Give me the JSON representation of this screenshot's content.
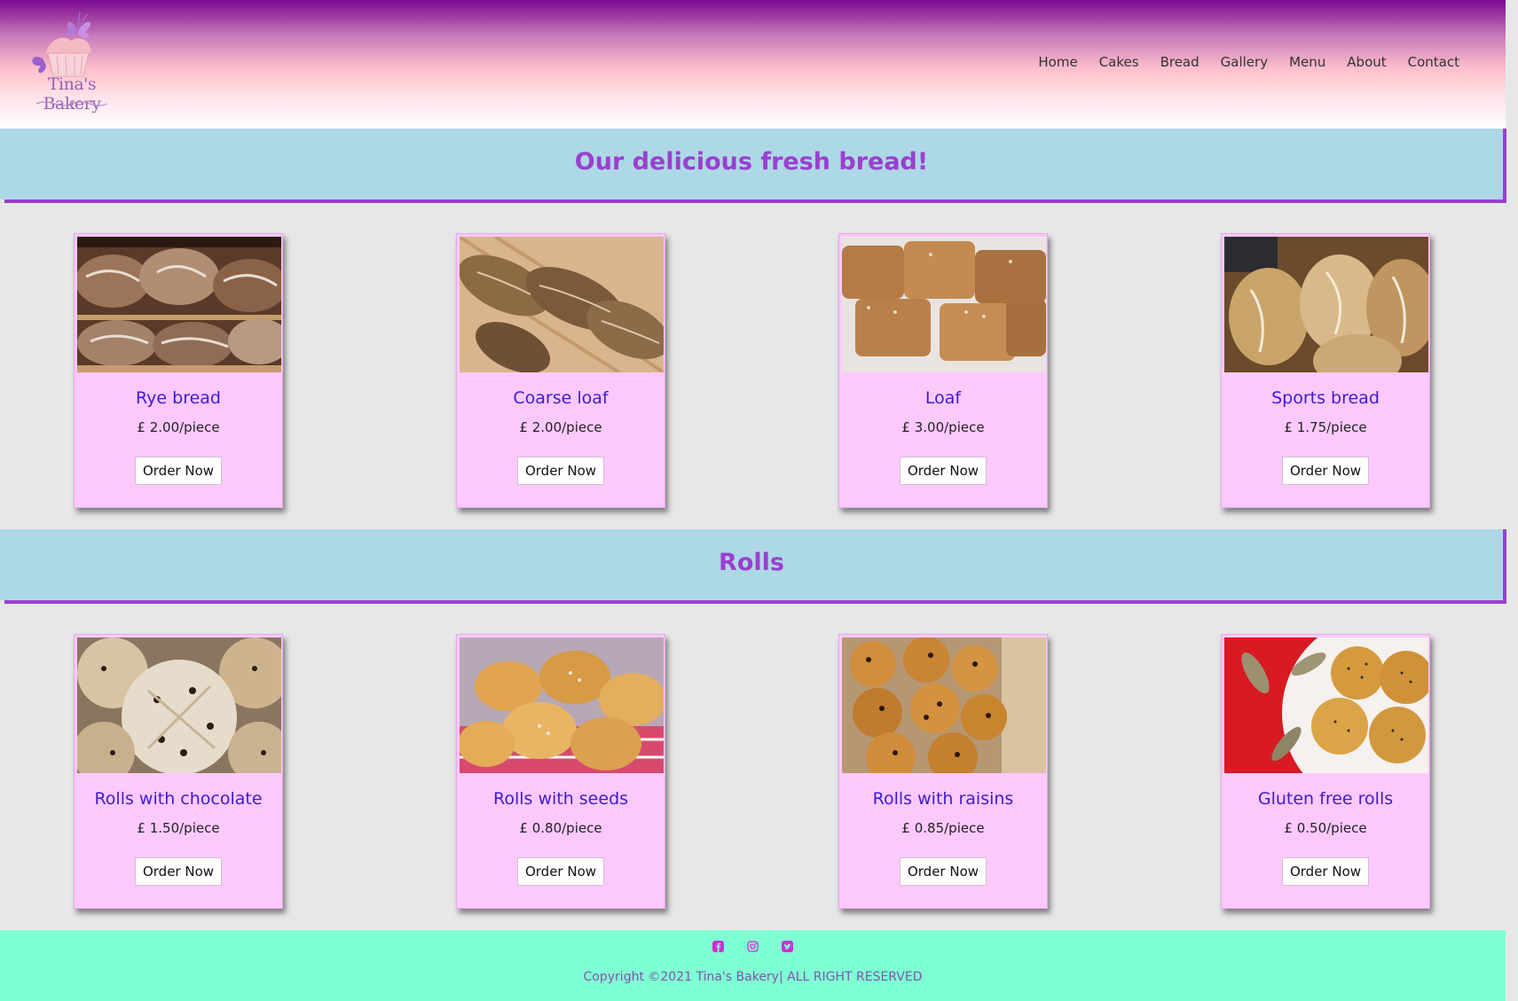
{
  "header": {
    "logo_text": "Tina's Bakery",
    "nav": [
      "Home",
      "Cakes",
      "Bread",
      "Gallery",
      "Menu",
      "About",
      "Contact"
    ]
  },
  "bread_section": {
    "title": "Our delicious fresh bread!",
    "items": [
      {
        "name": "Rye bread",
        "price": "£ 2.00/piece",
        "button": "Order Now"
      },
      {
        "name": "Coarse loaf",
        "price": "£ 2.00/piece",
        "button": "Order Now"
      },
      {
        "name": "Loaf",
        "price": "£ 3.00/piece",
        "button": "Order Now"
      },
      {
        "name": "Sports bread",
        "price": "£ 1.75/piece",
        "button": "Order Now"
      }
    ]
  },
  "rolls_section": {
    "title": "Rolls",
    "items": [
      {
        "name": "Rolls with chocolate",
        "price": "£ 1.50/piece",
        "button": "Order Now"
      },
      {
        "name": "Rolls with seeds",
        "price": "£ 0.80/piece",
        "button": "Order Now"
      },
      {
        "name": "Rolls with raisins",
        "price": "£ 0.85/piece",
        "button": "Order Now"
      },
      {
        "name": "Gluten free rolls",
        "price": "£ 0.50/piece",
        "button": "Order Now"
      }
    ]
  },
  "footer": {
    "social_icons": [
      "facebook-icon",
      "instagram-icon",
      "twitter-icon"
    ],
    "copyright": "Copyright ©2021 Tina's Bakery| ALL RIGHT RESERVED"
  },
  "colors": {
    "header_gradient_top": "#7b0a8e",
    "section_band": "#add8e6",
    "section_title": "#9b3fcf",
    "card_bg": "#fdc9fd",
    "product_name": "#3d1bd3",
    "footer_bg": "#7fffd4",
    "social_icon": "#d42bd4"
  }
}
